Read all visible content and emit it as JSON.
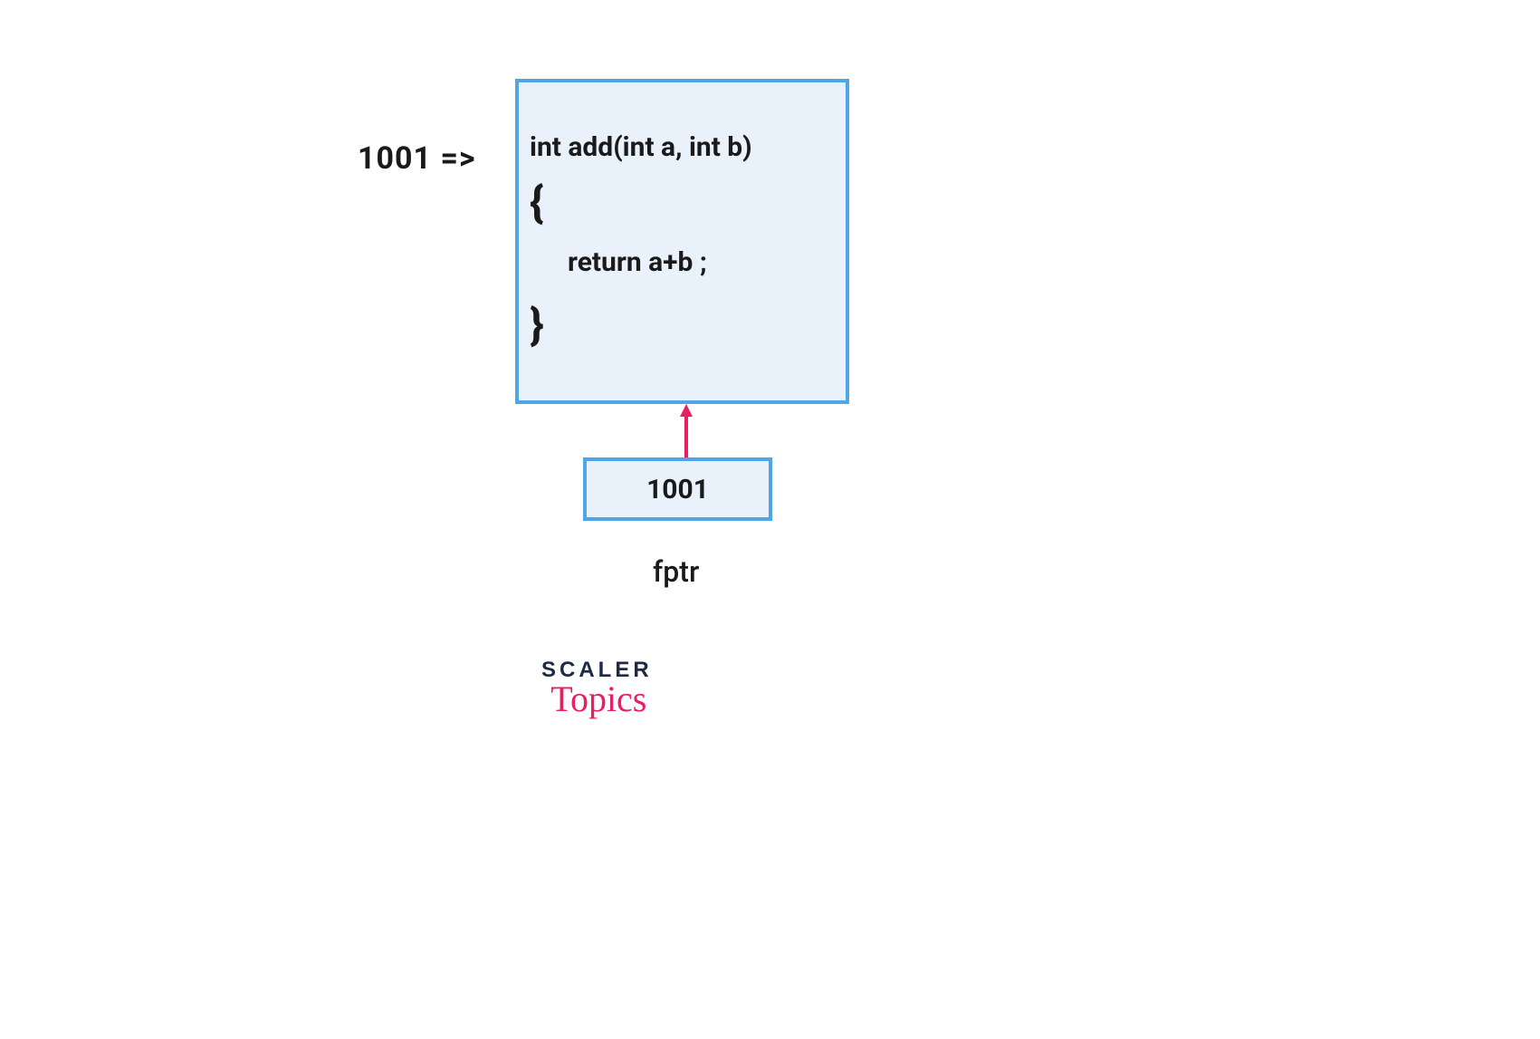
{
  "diagram": {
    "address_label": "1001  =>",
    "code": {
      "signature": "int add(int a, int b)",
      "brace_open": "{",
      "body": "return a+b ;",
      "brace_close": "}"
    },
    "pointer": {
      "value": "1001",
      "name": "fptr"
    },
    "colors": {
      "box_border": "#50a5e6",
      "box_fill": "#e9f2fb",
      "arrow": "#e91e63",
      "text": "#1a1a1a",
      "logo_dark": "#1e2a44",
      "logo_pink": "#e91e63"
    }
  },
  "branding": {
    "line1": "SCALER",
    "line2": "Topics"
  }
}
